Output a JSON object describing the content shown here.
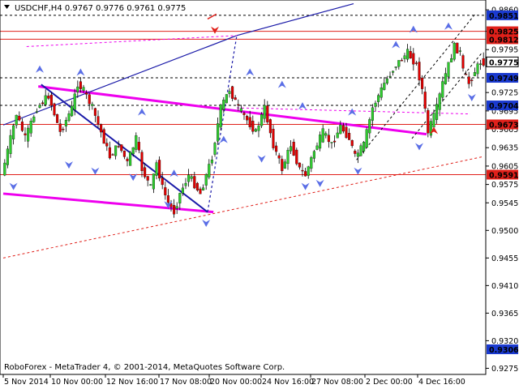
{
  "header": {
    "symbol_line": "USDCHF,H4  0.9767 0.9776 0.9761 0.9775"
  },
  "footer": {
    "copyright": "RoboForex - MetaTrader 4, © 2001-2014, MetaQuotes Software Corp."
  },
  "colors": {
    "up": "#2ecc2e",
    "down": "#e00000",
    "level_line": "#e0201a",
    "channel": "#ee00ee",
    "trend": "#1a1aa8",
    "arrow": "#5a6ee6",
    "highlight_badge": "#1a3ad0"
  },
  "chart_data": {
    "type": "candlestick",
    "symbol": "USDCHF",
    "timeframe": "H4",
    "last_bar": {
      "open": 0.9767,
      "high": 0.9776,
      "low": 0.9761,
      "close": 0.9775
    },
    "ylim": [
      0.9265,
      0.9876
    ],
    "y_ticks": [
      0.986,
      0.9825,
      0.9795,
      0.9775,
      0.9725,
      0.9695,
      0.9665,
      0.9635,
      0.9605,
      0.9575,
      0.9545,
      0.95,
      0.9455,
      0.941,
      0.9365,
      0.932,
      0.9275
    ],
    "x_ticks": [
      "5 Nov 2014",
      "10 Nov 00:00",
      "12 Nov 16:00",
      "17 Nov 08:00",
      "20 Nov 00:00",
      "24 Nov 16:00",
      "27 Nov 08:00",
      "2 Dec 00:00",
      "4 Dec 16:00"
    ],
    "levels": [
      {
        "value": 0.9851,
        "label": "0.9851",
        "style": "dashed",
        "badge": "dark"
      },
      {
        "value": 0.9825,
        "label": "0.9825",
        "style": "solid",
        "badge": "red"
      },
      {
        "value": 0.9812,
        "label": "0.9812",
        "style": "solid",
        "badge": "red"
      },
      {
        "value": 0.9775,
        "label": "0.9775",
        "style": "none",
        "badge": "dark"
      },
      {
        "value": 0.9749,
        "label": "0.9749",
        "style": "dashed",
        "badge": "dark"
      },
      {
        "value": 0.9704,
        "label": "0.9704",
        "style": "dashed",
        "badge": "dark"
      },
      {
        "value": 0.9673,
        "label": "0.9673",
        "style": "solid",
        "badge": "red"
      },
      {
        "value": 0.9591,
        "label": "0.9591",
        "style": "solid",
        "badge": "red"
      },
      {
        "value": 0.9306,
        "label": "0.9306",
        "style": "none",
        "badge": "dark"
      }
    ],
    "path": [
      [
        0,
        0.959
      ],
      [
        5,
        0.969
      ],
      [
        8,
        0.965
      ],
      [
        12,
        0.97
      ],
      [
        16,
        0.972
      ],
      [
        20,
        0.966
      ],
      [
        24,
        0.97
      ],
      [
        26,
        0.974
      ],
      [
        28,
        0.9728
      ],
      [
        31,
        0.97
      ],
      [
        34,
        0.966
      ],
      [
        37,
        0.962
      ],
      [
        40,
        0.964
      ],
      [
        43,
        0.961
      ],
      [
        46,
        0.965
      ],
      [
        48,
        0.96
      ],
      [
        51,
        0.957
      ],
      [
        53,
        0.961
      ],
      [
        55,
        0.957
      ],
      [
        57,
        0.9545
      ],
      [
        59,
        0.953
      ],
      [
        61,
        0.956
      ],
      [
        64,
        0.959
      ],
      [
        68,
        0.956
      ],
      [
        72,
        0.962
      ],
      [
        75,
        0.97
      ],
      [
        78,
        0.973
      ],
      [
        81,
        0.97
      ],
      [
        84,
        0.968
      ],
      [
        87,
        0.966
      ],
      [
        90,
        0.97
      ],
      [
        93,
        0.964
      ],
      [
        96,
        0.96
      ],
      [
        99,
        0.964
      ],
      [
        102,
        0.96
      ],
      [
        104,
        0.959
      ],
      [
        107,
        0.963
      ],
      [
        110,
        0.966
      ],
      [
        113,
        0.964
      ],
      [
        116,
        0.967
      ],
      [
        119,
        0.965
      ],
      [
        121,
        0.962
      ],
      [
        124,
        0.964
      ],
      [
        127,
        0.97
      ],
      [
        131,
        0.974
      ],
      [
        135,
        0.977
      ],
      [
        139,
        0.979
      ],
      [
        142,
        0.977
      ],
      [
        144,
        0.973
      ],
      [
        146,
        0.966
      ],
      [
        149,
        0.97
      ],
      [
        151,
        0.974
      ],
      [
        153,
        0.977
      ],
      [
        155,
        0.98
      ],
      [
        157,
        0.979
      ],
      [
        158,
        0.976
      ],
      [
        160,
        0.974
      ],
      [
        162,
        0.976
      ],
      [
        164,
        0.9775
      ]
    ]
  }
}
